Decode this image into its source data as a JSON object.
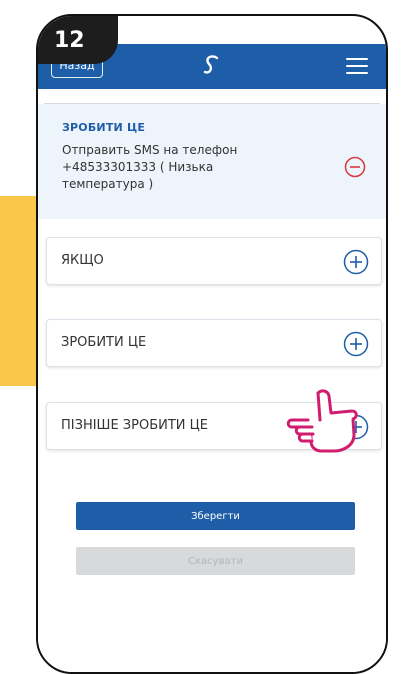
{
  "step": {
    "number": "12"
  },
  "header": {
    "back_label": "Назад",
    "logo_icon": "s-logo-icon",
    "menu_icon": "hamburger-menu-icon"
  },
  "action": {
    "title": "ЗРОБИТИ ЦЕ",
    "description": "Отправить SMS на телефон +48533301333 ( Низька температура )",
    "remove_icon": "minus-circle-icon"
  },
  "sections": [
    {
      "label": "ЯКЩО",
      "icon": "plus-circle-icon"
    },
    {
      "label": "ЗРОБИТИ ЦЕ",
      "icon": "plus-circle-icon"
    },
    {
      "label": "ПІЗНІШЕ ЗРОБИТИ ЦЕ",
      "icon": "plus-circle-icon"
    }
  ],
  "buttons": {
    "save_label": "Зберегти",
    "cancel_label": "Скасувати"
  },
  "colors": {
    "brand_blue": "#1e5ea8",
    "remove_red": "#d9383e",
    "arrow_yellow": "#f9c84a",
    "hand_pink": "#d11d6f",
    "disabled_gray": "#d8d9db"
  }
}
